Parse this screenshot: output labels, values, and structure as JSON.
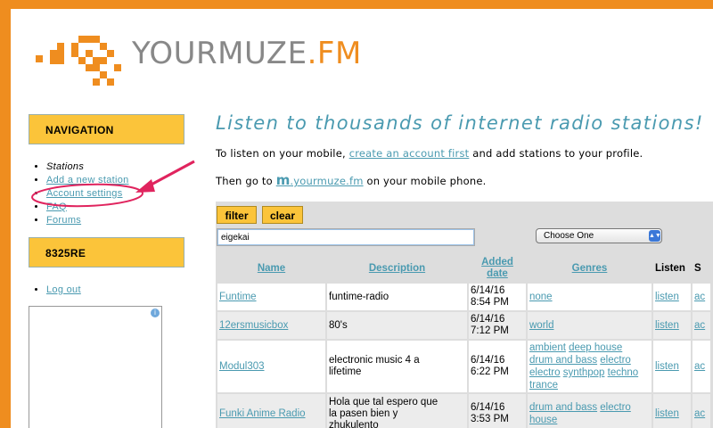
{
  "brand": {
    "text_a": "YOURMUZE",
    "text_b": ".FM",
    "color": "#ef8d1f"
  },
  "colors": {
    "accent": "#ef8d1f",
    "box": "#fbc43a",
    "link": "#4a9ab0",
    "annotation": "#e0245e"
  },
  "sidebar": {
    "nav_title": "NAVIGATION",
    "nav_items": [
      {
        "label": "Stations"
      },
      {
        "label": "Add a new station"
      },
      {
        "label": "Account settings"
      },
      {
        "label": "FAQ"
      },
      {
        "label": "Forums"
      }
    ],
    "user_title": "8325RE",
    "logout": "Log out",
    "ad_icon": "info-icon"
  },
  "main": {
    "tagline": "Listen to thousands of internet radio stations!",
    "p1_before": "To listen on your mobile, ",
    "p1_link": "create an account first",
    "p1_after": " and add stations to your profile.",
    "p2_before": "Then go to ",
    "p2_m": "m",
    "p2_domain": ".yourmuze.fm",
    "p2_after": " on your mobile phone."
  },
  "filter": {
    "filter_label": "filter",
    "clear_label": "clear",
    "input_value": "eigekai",
    "select_value": "Choose One"
  },
  "table": {
    "headers": {
      "name": "Name",
      "description": "Description",
      "added_1": "Added",
      "added_2": "date",
      "genres": "Genres",
      "listen": "Listen",
      "extra": "S"
    },
    "rows": [
      {
        "name": "Funtime",
        "desc1": "funtime-radio",
        "desc2": "",
        "date1": "6/14/16",
        "date2": "8:54 PM",
        "g1": "none",
        "g2": "",
        "g3": "",
        "listen": "listen",
        "extra": "ac"
      },
      {
        "name": "12ersmusicbox",
        "desc1": "80's",
        "desc2": "",
        "date1": "6/14/16",
        "date2": "7:12 PM",
        "g1": "world",
        "g2": "",
        "g3": "",
        "listen": "listen",
        "extra": "ac"
      },
      {
        "name": "Modul303",
        "desc1": "electronic music 4 a",
        "desc2": "lifetime",
        "date1": "6/14/16",
        "date2": "6:22 PM",
        "genres": [
          "ambient",
          "deep house",
          "drum and bass",
          "electro",
          "electro",
          "synthpop",
          "techno",
          "trance"
        ],
        "listen": "listen",
        "extra": "ac"
      },
      {
        "name": "Funki Anime Radio",
        "desc1": "Hola que tal espero que",
        "desc2": "la pasen bien y",
        "desc3": "zhukulento",
        "date1": "6/14/16",
        "date2": "3:53 PM",
        "genres": [
          "drum and bass",
          "electro",
          "house"
        ],
        "listen": "listen",
        "extra": "ac"
      }
    ]
  }
}
